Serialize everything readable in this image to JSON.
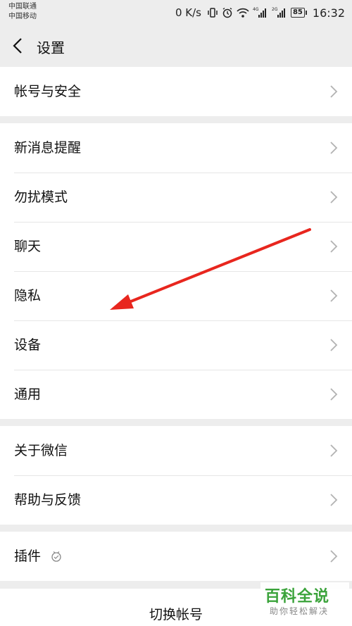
{
  "status_bar": {
    "carrier1": "中国联通",
    "carrier2": "中国移动",
    "net_speed": "0 K/s",
    "net_tag_1": "4G",
    "net_tag_2": "2G",
    "battery": "85",
    "time": "16:32",
    "icons": [
      "vibrate-icon",
      "alarm-icon",
      "wifi-icon",
      "signal-4g-icon",
      "signal-2g-icon",
      "battery-icon"
    ]
  },
  "header": {
    "title": "设置",
    "back_icon": "chevron-left-icon"
  },
  "groups": [
    {
      "items": [
        {
          "label": "帐号与安全"
        }
      ]
    },
    {
      "items": [
        {
          "label": "新消息提醒"
        },
        {
          "label": "勿扰模式"
        },
        {
          "label": "聊天"
        },
        {
          "label": "隐私"
        },
        {
          "label": "设备"
        },
        {
          "label": "通用"
        }
      ]
    },
    {
      "items": [
        {
          "label": "关于微信"
        },
        {
          "label": "帮助与反馈"
        }
      ]
    },
    {
      "items": [
        {
          "label": "插件",
          "icon": "plugin-icon"
        }
      ]
    }
  ],
  "switch_account": "切换帐号",
  "colors": {
    "background": "#ededed",
    "card": "#ffffff",
    "arrow": "#e8261e",
    "watermark": "#3ba33b"
  },
  "watermark": {
    "main": "百科全说",
    "sub": "助你轻松解决"
  }
}
